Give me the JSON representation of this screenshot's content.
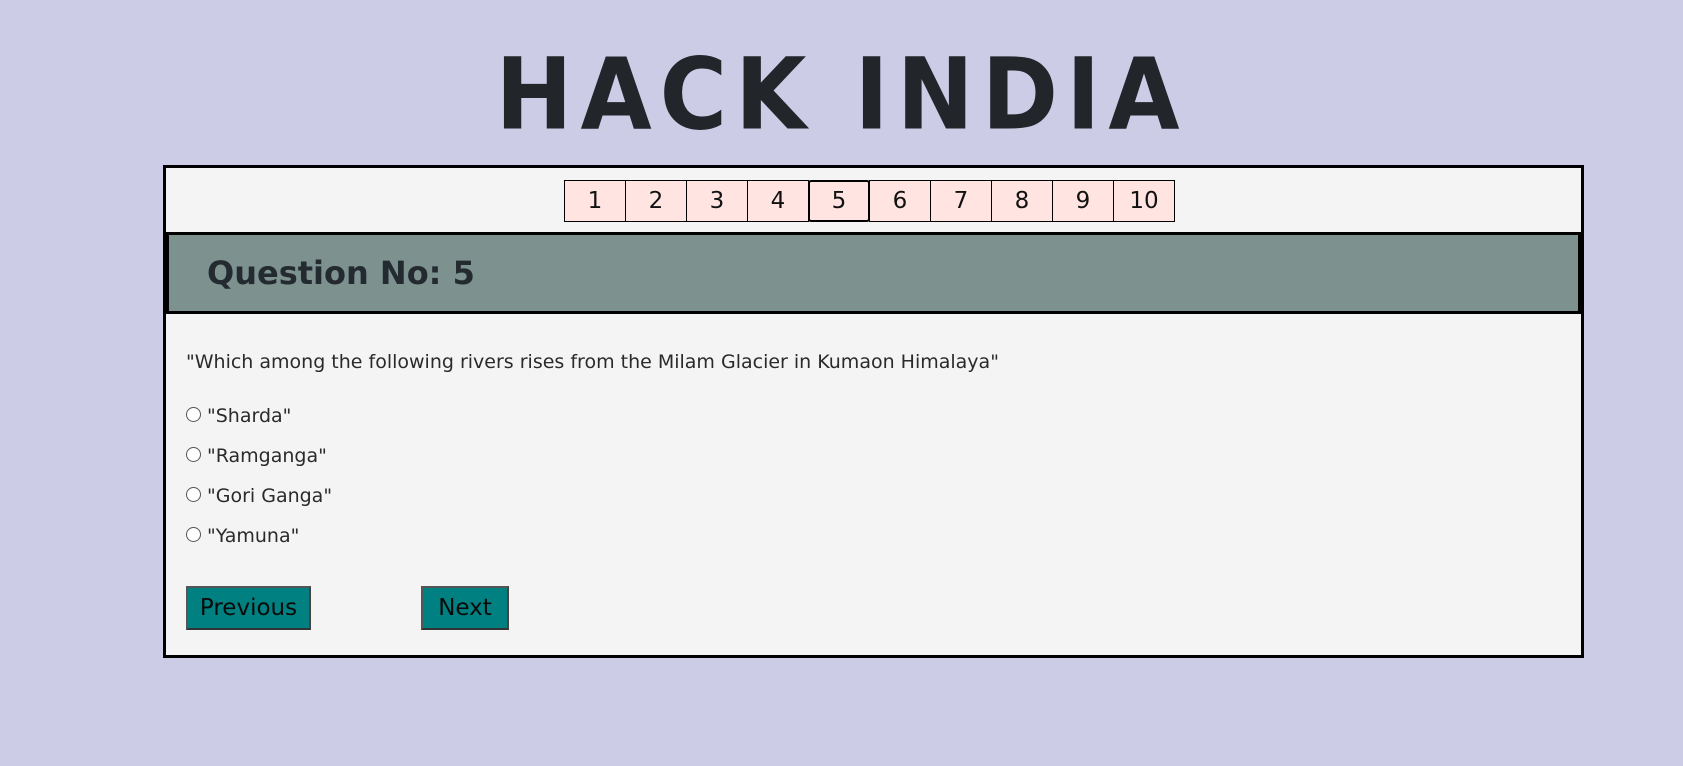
{
  "header": {
    "logo_text": "HACK INDIA"
  },
  "nav": {
    "buttons": [
      "1",
      "2",
      "3",
      "4",
      "5",
      "6",
      "7",
      "8",
      "9",
      "10"
    ],
    "active_index": 4
  },
  "question": {
    "heading": "Question No: 5",
    "text": "\"Which among the following rivers rises from the Milam Glacier in Kumaon Himalaya\"",
    "options": [
      "\"Sharda\"",
      "\"Ramganga\"",
      "\"Gori Ganga\"",
      "\"Yamuna\""
    ]
  },
  "controls": {
    "previous_label": "Previous",
    "next_label": "Next"
  },
  "colors": {
    "page_background": "#cccce6",
    "panel_background": "#f4f4f4",
    "nav_button": "#ffe4e1",
    "question_header": "#7d918f",
    "action_button": "#008080"
  }
}
